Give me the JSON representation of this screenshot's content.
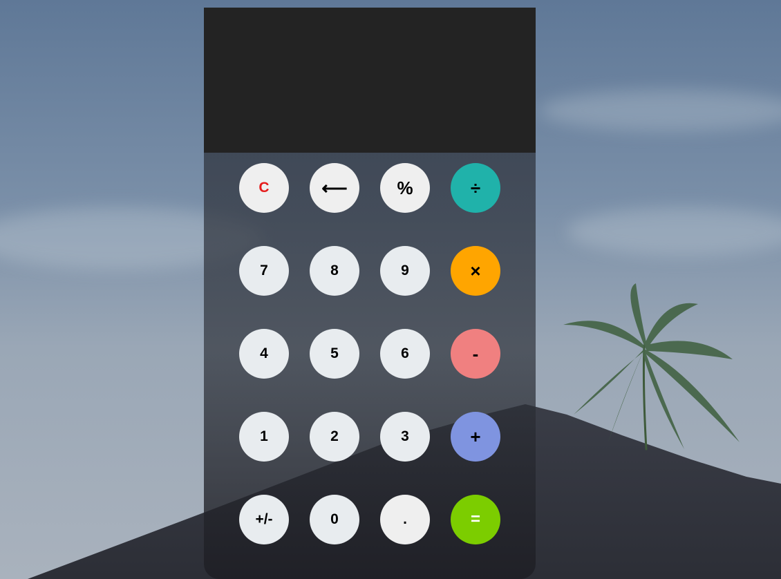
{
  "display": {
    "value": ""
  },
  "colors": {
    "display_bg": "#232323",
    "divide": "#20b2aa",
    "multiply": "#ffa500",
    "minus": "#f08080",
    "plus": "#7f94e0",
    "equals": "#7ccd00",
    "clear_text": "#e51c1c",
    "digit_bg": "#e8ecef"
  },
  "keys": {
    "clear": "C",
    "backspace": "⟵",
    "percent": "%",
    "divide": "÷",
    "seven": "7",
    "eight": "8",
    "nine": "9",
    "multiply": "×",
    "four": "4",
    "five": "5",
    "six": "6",
    "minus": "-",
    "one": "1",
    "two": "2",
    "three": "3",
    "plus": "+",
    "negate": "+/-",
    "zero": "0",
    "decimal": ".",
    "equals": "="
  },
  "icons": {
    "backspace": "backspace-arrow-icon"
  }
}
